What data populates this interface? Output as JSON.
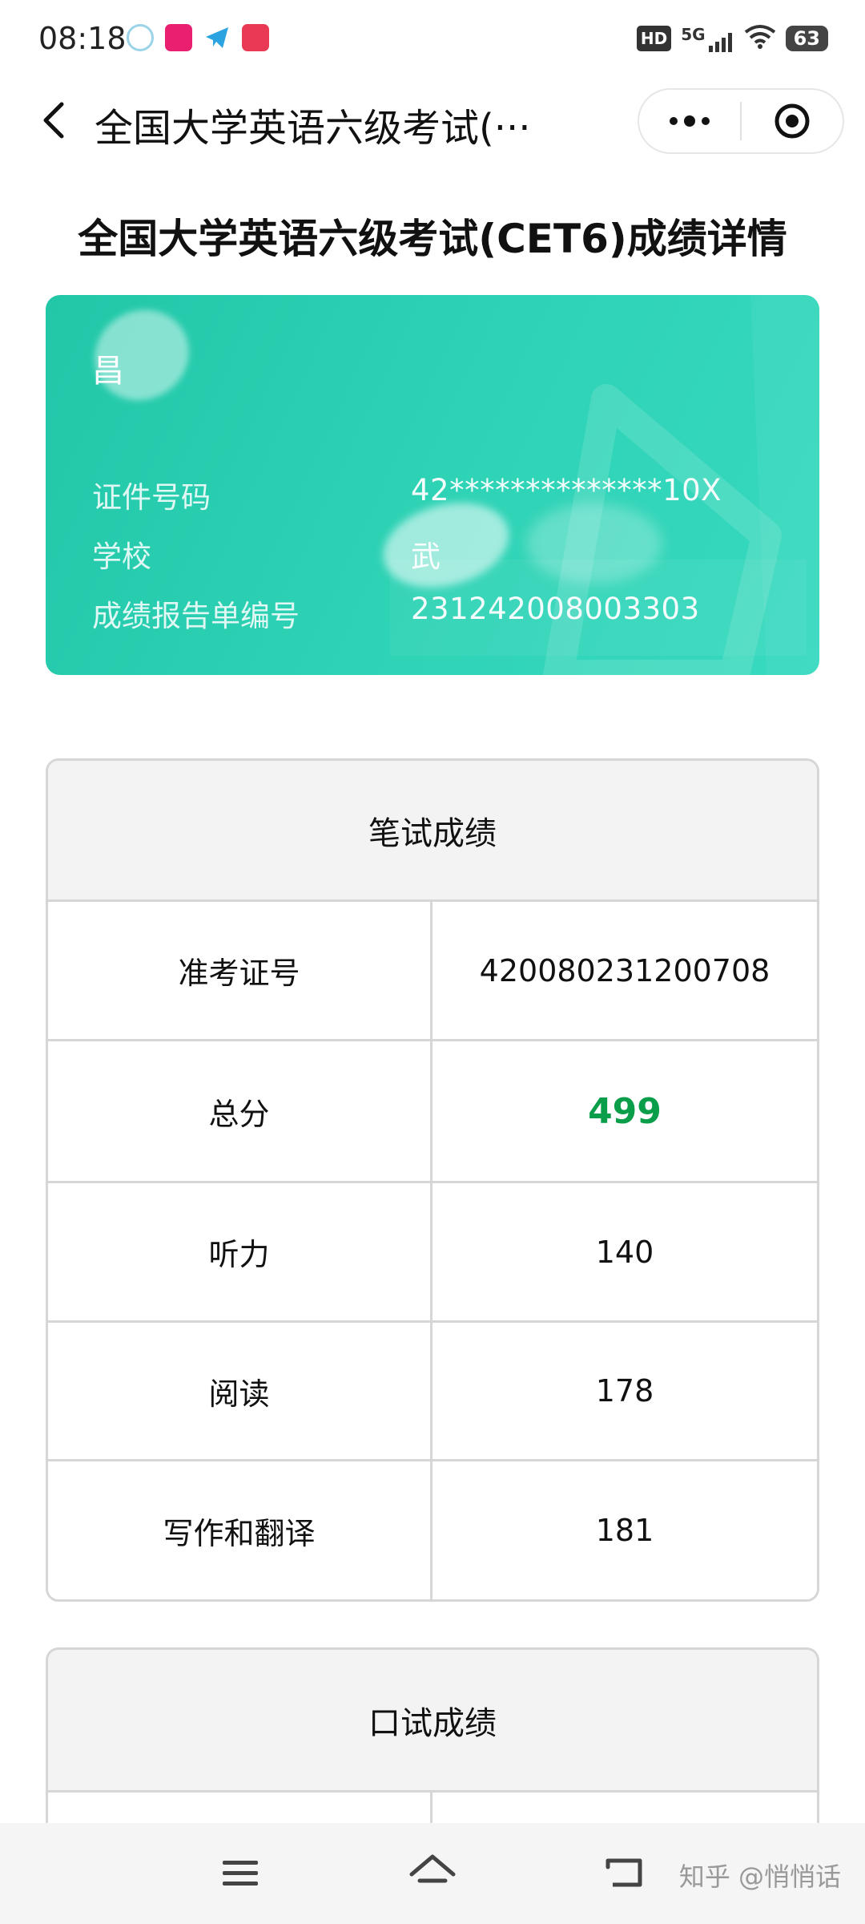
{
  "status_bar": {
    "time": "08:18",
    "network": "5G",
    "hd_label": "HD",
    "battery": "63"
  },
  "nav": {
    "title": "全国大学英语六级考试(···"
  },
  "page_title": "全国大学英语六级考试(CET6)成绩详情",
  "card": {
    "name": "昌",
    "id_label": "证件号码",
    "id_value": "42**************10X",
    "school_label": "学校",
    "school_value": "武",
    "report_label": "成绩报告单编号",
    "report_value": "231242008003303"
  },
  "written": {
    "header": "笔试成绩",
    "rows": [
      {
        "label": "准考证号",
        "value": "420080231200708"
      },
      {
        "label": "总分",
        "value": "499"
      },
      {
        "label": "听力",
        "value": "140"
      },
      {
        "label": "阅读",
        "value": "178"
      },
      {
        "label": "写作和翻译",
        "value": "181"
      }
    ]
  },
  "oral": {
    "header": "口试成绩"
  },
  "watermark": "知乎 @悄悄话",
  "colors": {
    "card_accent": "#2fd3b6",
    "total_score": "#0a9e4a"
  }
}
